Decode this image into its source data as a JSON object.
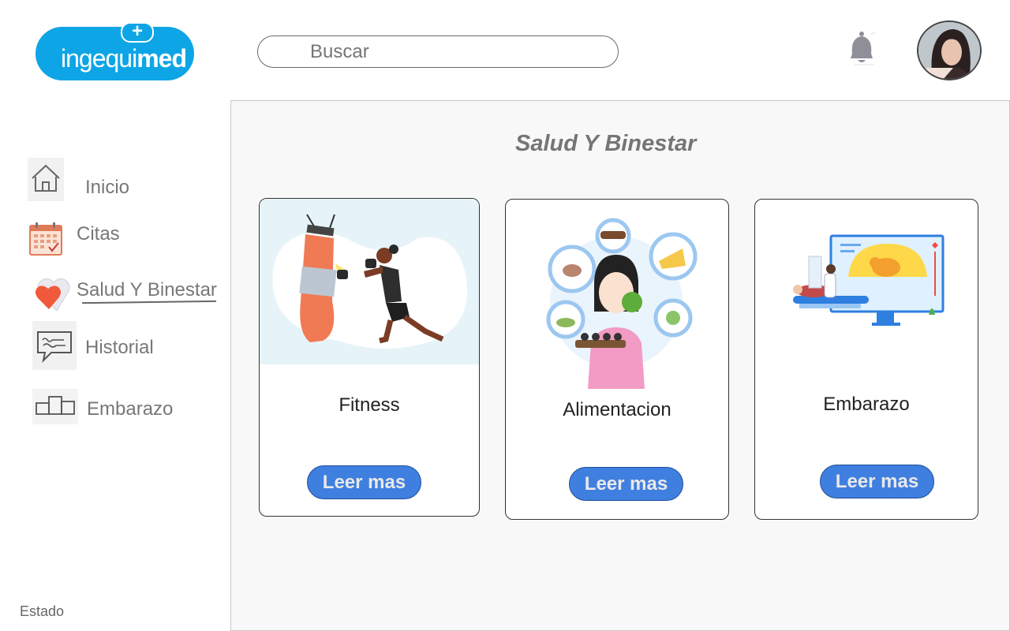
{
  "header": {
    "logo": {
      "text_light": "ingequi",
      "text_bold": "med",
      "bubble_glyph": "+"
    },
    "search": {
      "placeholder": "Buscar",
      "value": ""
    },
    "notifications_icon": "bell-icon",
    "avatar_icon": "user-avatar"
  },
  "sidebar": {
    "items": [
      {
        "label": "Inicio",
        "icon": "home-icon"
      },
      {
        "label": "Citas",
        "icon": "calendar-icon"
      },
      {
        "label": "Salud Y Binestar",
        "icon": "heart-icon",
        "active": true
      },
      {
        "label": "Historial",
        "icon": "chat-icon"
      },
      {
        "label": "Embarazo",
        "icon": "podium-icon"
      }
    ],
    "footer_text": "Estado"
  },
  "main": {
    "title": "Salud Y Binestar",
    "cards": [
      {
        "title": "Fitness",
        "button_label": "Leer mas",
        "image": "boxing-illustration"
      },
      {
        "title": "Alimentacion",
        "button_label": "Leer mas",
        "image": "healthy-food-illustration"
      },
      {
        "title": "Embarazo",
        "button_label": "Leer mas",
        "image": "ultrasound-illustration"
      }
    ]
  },
  "colors": {
    "brand": "#0ea5e6",
    "button": "#3f7fe0",
    "panel_background": "#f8f8f8"
  }
}
